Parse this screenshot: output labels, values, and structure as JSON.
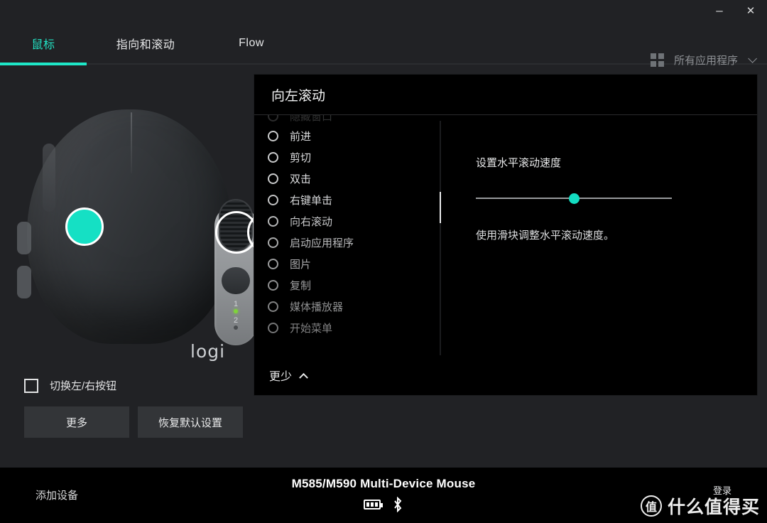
{
  "window": {
    "minimize_label": "–",
    "close_label": "✕"
  },
  "tabs": [
    {
      "label": "鼠标",
      "active": true
    },
    {
      "label": "指向和滚动",
      "active": false
    },
    {
      "label": "Flow",
      "active": false
    }
  ],
  "apps_filter": {
    "icon": "grid-icon",
    "label": "所有应用程序",
    "chevron": "chevron-down-icon"
  },
  "device_image": {
    "brand_logo": "logi",
    "device_slot_1": "1",
    "device_slot_2": "2"
  },
  "left_controls": {
    "swap_buttons_label": "切换左/右按钮",
    "swap_buttons_checked": false,
    "more_button": "更多",
    "restore_defaults_button": "恢复默认设置"
  },
  "dialog": {
    "title": "向左滚动",
    "options": [
      {
        "label": "隐藏窗口",
        "selected": false,
        "clipped": true
      },
      {
        "label": "前进",
        "selected": false
      },
      {
        "label": "剪切",
        "selected": false
      },
      {
        "label": "双击",
        "selected": false
      },
      {
        "label": "右键单击",
        "selected": false
      },
      {
        "label": "向右滚动",
        "selected": false
      },
      {
        "label": "启动应用程序",
        "selected": false
      },
      {
        "label": "图片",
        "selected": false
      },
      {
        "label": "复制",
        "selected": false
      },
      {
        "label": "媒体播放器",
        "selected": false
      },
      {
        "label": "开始菜单",
        "selected": false
      }
    ],
    "right_panel": {
      "title": "设置水平滚动速度",
      "slider_value_percent": 50,
      "help_text": "使用滑块调整水平滚动速度。"
    },
    "footer": {
      "less_label": "更少",
      "chevron": "chevron-up-icon"
    }
  },
  "bottom_bar": {
    "add_device_label": "添加设备",
    "device_name": "M585/M590 Multi-Device Mouse",
    "battery_icon": "battery-full-icon",
    "bluetooth_icon": "bluetooth-icon",
    "login_label": "登录",
    "watermark_badge": "值",
    "watermark_text": "什么值得买"
  },
  "colors": {
    "accent": "#1ee8c8",
    "app_bg": "#212225",
    "dialog_bg": "#000000",
    "bottom_bar_bg": "#000000"
  }
}
